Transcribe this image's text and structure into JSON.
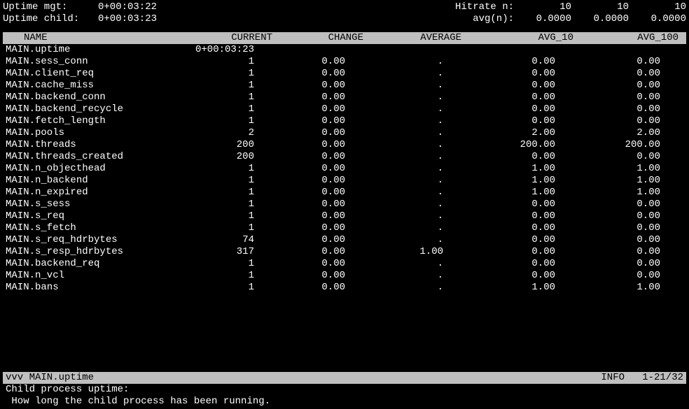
{
  "top": {
    "uptime_mgt_label": "Uptime mgt:",
    "uptime_mgt_val": "0+00:03:22",
    "uptime_child_label": "Uptime child:",
    "uptime_child_val": "0+00:03:23",
    "hitrate_label": "Hitrate n:",
    "hitrate_vals": [
      "10",
      "10",
      "10"
    ],
    "avg_label": "avg(n):",
    "avg_vals": [
      "0.0000",
      "0.0000",
      "0.0000"
    ]
  },
  "columns": {
    "name": "NAME",
    "current": "CURRENT",
    "change": "CHANGE",
    "average": "AVERAGE",
    "avg10": "AVG_10",
    "avg100": "AVG_100"
  },
  "rows": [
    {
      "name": "MAIN.uptime",
      "current": "0+00:03:23",
      "change": "",
      "average": "",
      "avg10": "",
      "avg100": ""
    },
    {
      "name": "MAIN.sess_conn",
      "current": "1",
      "change": "0.00",
      "average": ".",
      "avg10": "0.00",
      "avg100": "0.00"
    },
    {
      "name": "MAIN.client_req",
      "current": "1",
      "change": "0.00",
      "average": ".",
      "avg10": "0.00",
      "avg100": "0.00"
    },
    {
      "name": "MAIN.cache_miss",
      "current": "1",
      "change": "0.00",
      "average": ".",
      "avg10": "0.00",
      "avg100": "0.00"
    },
    {
      "name": "MAIN.backend_conn",
      "current": "1",
      "change": "0.00",
      "average": ".",
      "avg10": "0.00",
      "avg100": "0.00"
    },
    {
      "name": "MAIN.backend_recycle",
      "current": "1",
      "change": "0.00",
      "average": ".",
      "avg10": "0.00",
      "avg100": "0.00"
    },
    {
      "name": "MAIN.fetch_length",
      "current": "1",
      "change": "0.00",
      "average": ".",
      "avg10": "0.00",
      "avg100": "0.00"
    },
    {
      "name": "MAIN.pools",
      "current": "2",
      "change": "0.00",
      "average": ".",
      "avg10": "2.00",
      "avg100": "2.00"
    },
    {
      "name": "MAIN.threads",
      "current": "200",
      "change": "0.00",
      "average": ".",
      "avg10": "200.00",
      "avg100": "200.00"
    },
    {
      "name": "MAIN.threads_created",
      "current": "200",
      "change": "0.00",
      "average": ".",
      "avg10": "0.00",
      "avg100": "0.00"
    },
    {
      "name": "MAIN.n_objecthead",
      "current": "1",
      "change": "0.00",
      "average": ".",
      "avg10": "1.00",
      "avg100": "1.00"
    },
    {
      "name": "MAIN.n_backend",
      "current": "1",
      "change": "0.00",
      "average": ".",
      "avg10": "1.00",
      "avg100": "1.00"
    },
    {
      "name": "MAIN.n_expired",
      "current": "1",
      "change": "0.00",
      "average": ".",
      "avg10": "1.00",
      "avg100": "1.00"
    },
    {
      "name": "MAIN.s_sess",
      "current": "1",
      "change": "0.00",
      "average": ".",
      "avg10": "0.00",
      "avg100": "0.00"
    },
    {
      "name": "MAIN.s_req",
      "current": "1",
      "change": "0.00",
      "average": ".",
      "avg10": "0.00",
      "avg100": "0.00"
    },
    {
      "name": "MAIN.s_fetch",
      "current": "1",
      "change": "0.00",
      "average": ".",
      "avg10": "0.00",
      "avg100": "0.00"
    },
    {
      "name": "MAIN.s_req_hdrbytes",
      "current": "74",
      "change": "0.00",
      "average": ".",
      "avg10": "0.00",
      "avg100": "0.00"
    },
    {
      "name": "MAIN.s_resp_hdrbytes",
      "current": "317",
      "change": "0.00",
      "average": "1.00",
      "avg10": "0.00",
      "avg100": "0.00"
    },
    {
      "name": "MAIN.backend_req",
      "current": "1",
      "change": "0.00",
      "average": ".",
      "avg10": "0.00",
      "avg100": "0.00"
    },
    {
      "name": "MAIN.n_vcl",
      "current": "1",
      "change": "0.00",
      "average": ".",
      "avg10": "0.00",
      "avg100": "0.00"
    },
    {
      "name": "MAIN.bans",
      "current": "1",
      "change": "0.00",
      "average": ".",
      "avg10": "1.00",
      "avg100": "1.00"
    }
  ],
  "status": {
    "selected": "vvv MAIN.uptime",
    "info_label": "INFO",
    "paging": "1-21/32"
  },
  "description": {
    "line1": "Child process uptime:",
    "line2": " How long the child process has been running."
  }
}
